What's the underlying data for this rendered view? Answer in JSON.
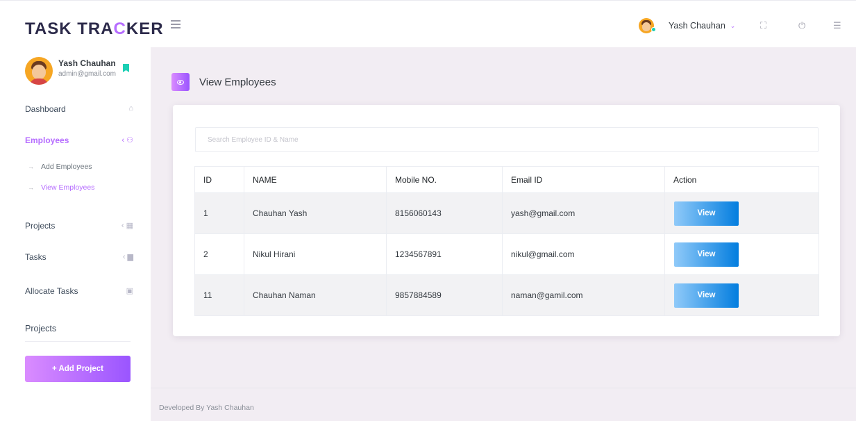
{
  "app": {
    "logo_part1": "TASK TRA",
    "logo_accent": "C",
    "logo_part2": "KER"
  },
  "header": {
    "user_name": "Yash Chauhan",
    "chevron": "⌄",
    "icons": [
      "menu-icon",
      "fullscreen-icon",
      "power-icon",
      "list-icon"
    ]
  },
  "profile": {
    "name": "Yash Chauhan",
    "email": "admin@gmail.com"
  },
  "sidebar": {
    "items": [
      {
        "label": "Dashboard",
        "icon": "⌂"
      },
      {
        "label": "Employees",
        "icon": "‹ ⚇"
      },
      {
        "label": "Projects",
        "icon": "‹ ▦"
      },
      {
        "label": "Tasks",
        "icon": "‹ ▆"
      },
      {
        "label": "Allocate Tasks",
        "icon": "▣"
      }
    ],
    "sub_items": [
      {
        "label": "Add Employees"
      },
      {
        "label": "View Employees"
      }
    ],
    "section_title": "Projects",
    "add_project_label": "+ Add Project"
  },
  "page": {
    "title": "View Employees"
  },
  "search": {
    "placeholder": "Search Employee ID & Name",
    "value": ""
  },
  "table": {
    "columns": [
      "ID",
      "NAME",
      "Mobile NO.",
      "Email ID",
      "Action"
    ],
    "rows": [
      {
        "id": "1",
        "name": "Chauhan Yash",
        "mobile": "8156060143",
        "email": "yash@gmail.com",
        "action": "View"
      },
      {
        "id": "2",
        "name": "Nikul Hirani",
        "mobile": "1234567891",
        "email": "nikul@gmail.com",
        "action": "View"
      },
      {
        "id": "11",
        "name": "Chauhan Naman",
        "mobile": "9857884589",
        "email": "naman@gamil.com",
        "action": "View"
      }
    ]
  },
  "footer": {
    "text": "Developed By Yash Chauhan"
  },
  "colors": {
    "accent": "#b66dff",
    "view_button_start": "#90caf9",
    "view_button_end": "#047edf",
    "background": "#f2edf3"
  }
}
